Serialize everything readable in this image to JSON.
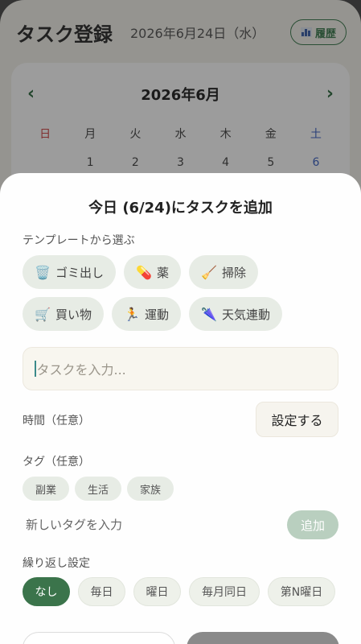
{
  "header": {
    "title": "タスク登録",
    "date": "2026年6月24日（水）",
    "history_label": "履歴"
  },
  "calendar": {
    "month": "2026年6月",
    "prev": "‹",
    "next": "›",
    "weekdays": [
      "日",
      "月",
      "火",
      "水",
      "木",
      "金",
      "土"
    ],
    "first_row": [
      "",
      "1",
      "2",
      "3",
      "4",
      "5",
      "6"
    ]
  },
  "sheet": {
    "title": "今日 (6/24)にタスクを追加",
    "template_label": "テンプレートから選ぶ",
    "templates": [
      {
        "icon": "🗑️",
        "icon_name": "trash-icon",
        "label": "ゴミ出し"
      },
      {
        "icon": "💊",
        "icon_name": "pill-icon",
        "label": "薬"
      },
      {
        "icon": "🧹",
        "icon_name": "broom-icon",
        "label": "掃除"
      },
      {
        "icon": "🛒",
        "icon_name": "cart-icon",
        "label": "買い物"
      },
      {
        "icon": "🏃",
        "icon_name": "runner-icon",
        "label": "運動"
      },
      {
        "icon": "🌂",
        "icon_name": "umbrella-icon",
        "label": "天気連動"
      }
    ],
    "task_placeholder": "タスクを入力...",
    "time_label": "時間（任意）",
    "time_button": "設定する",
    "tag_label": "タグ（任意）",
    "tags": [
      "副業",
      "生活",
      "家族"
    ],
    "new_tag_placeholder": "新しいタグを入力",
    "add_button": "追加",
    "repeat_label": "繰り返し設定",
    "repeat_options": [
      "なし",
      "毎日",
      "曜日",
      "毎月同日",
      "第N曜日"
    ],
    "repeat_selected": "なし"
  },
  "colors": {
    "accent": "#3b744b",
    "chip": "#e7ece5",
    "sunday": "#d04545",
    "saturday": "#3d63c4"
  }
}
